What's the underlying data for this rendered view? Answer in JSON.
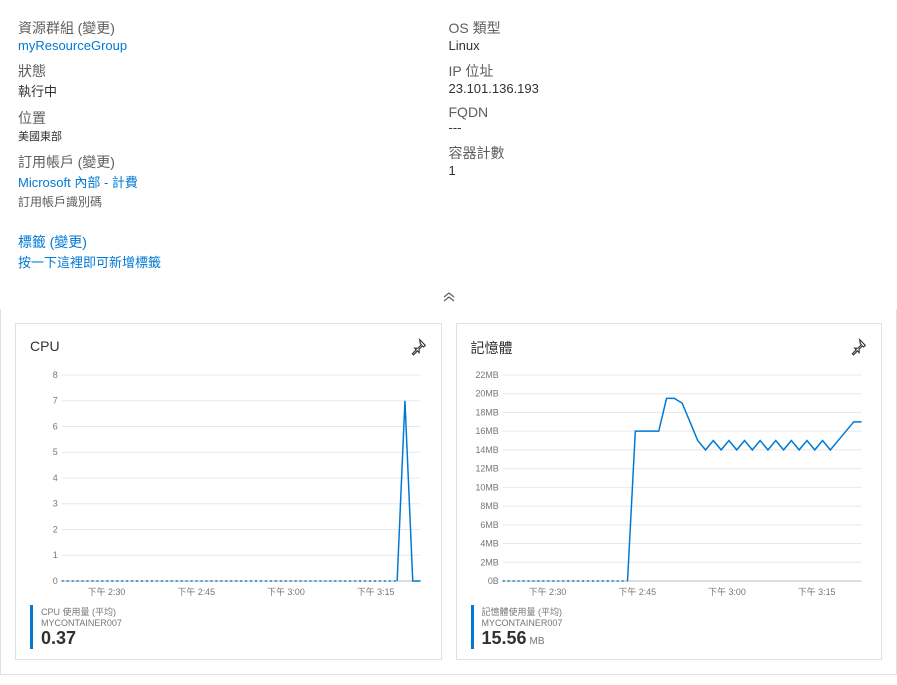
{
  "left": {
    "resource_group_label": "資源群組",
    "change_suffix": "(變更)",
    "resource_group_value": "myResourceGroup",
    "status_label": "狀態",
    "status_value": "執行中",
    "location_label": "位置",
    "location_value": "美國東部",
    "subscription_label": "訂用帳戶",
    "subscription_value": "Microsoft 內部 - 計費",
    "subscription_id_label": "訂用帳戶識別碼",
    "tags_label": "標籤",
    "tags_action": "按一下這裡即可新增標籤"
  },
  "right": {
    "os_type_label": "OS 類型",
    "os_type_value": "Linux",
    "ip_label": "IP 位址",
    "ip_value": "23.101.136.193",
    "fqdn_label": "FQDN",
    "fqdn_value": "---",
    "container_count_label": "容器計數",
    "container_count_value": "1"
  },
  "chart_cpu": {
    "title": "CPU",
    "legend_label": "CPU 使用量 (平均)",
    "legend_sub": "MYCONTAINER007",
    "legend_value": "0.37"
  },
  "chart_mem": {
    "title": "記憶體",
    "legend_label": "記憶體使用量 (平均)",
    "legend_sub": "MYCONTAINER007",
    "legend_value": "15.56",
    "legend_unit": "MB"
  },
  "x_ticks": [
    "下午 2:30",
    "下午 2:45",
    "下午 3:00",
    "下午 3:15"
  ],
  "chart_data": [
    {
      "type": "line",
      "title": "CPU",
      "ylabel": "",
      "xlabel": "",
      "ylim": [
        0,
        8
      ],
      "y_ticks": [
        0,
        1,
        2,
        3,
        4,
        5,
        6,
        7,
        8
      ],
      "x_categories": [
        "下午 2:30",
        "下午 2:45",
        "下午 3:00",
        "下午 3:15"
      ],
      "series": [
        {
          "name": "CPU 使用量 (平均) MYCONTAINER007",
          "avg": 0.37,
          "values": [
            0,
            0,
            0,
            0,
            0,
            0,
            0,
            0,
            0,
            0,
            0,
            0,
            0,
            0,
            0,
            0,
            0,
            0,
            0,
            0,
            0,
            0,
            0,
            0,
            0,
            0,
            0,
            0,
            0,
            0,
            0,
            0,
            0,
            0,
            0,
            0,
            0,
            0,
            0,
            0,
            0,
            0,
            0,
            0,
            7,
            0,
            0
          ]
        }
      ]
    },
    {
      "type": "line",
      "title": "記憶體",
      "ylabel": "MB",
      "xlabel": "",
      "ylim": [
        0,
        22
      ],
      "y_ticks": [
        "0B",
        "2MB",
        "4MB",
        "6MB",
        "8MB",
        "10MB",
        "12MB",
        "14MB",
        "16MB",
        "18MB",
        "20MB",
        "22MB"
      ],
      "x_categories": [
        "下午 2:30",
        "下午 2:45",
        "下午 3:00",
        "下午 3:15"
      ],
      "series": [
        {
          "name": "記憶體使用量 (平均) MYCONTAINER007",
          "avg_mb": 15.56,
          "values": [
            0,
            0,
            0,
            0,
            0,
            0,
            0,
            0,
            0,
            0,
            0,
            0,
            0,
            0,
            0,
            0,
            0,
            16,
            16,
            16,
            16,
            19.5,
            19.5,
            19,
            17,
            15,
            14,
            15,
            14,
            15,
            14,
            15,
            14,
            15,
            14,
            15,
            14,
            15,
            14,
            15,
            14,
            15,
            14,
            15,
            16,
            17,
            17
          ]
        }
      ]
    }
  ]
}
